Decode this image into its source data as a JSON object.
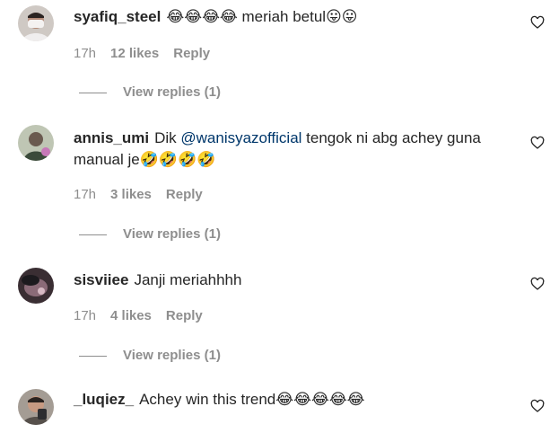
{
  "comments": [
    {
      "username": "syafiq_steel",
      "text_before": "",
      "mention": "",
      "text": "😂😂😂😂 meriah betul😛😛",
      "time": "17h",
      "likes": "12 likes",
      "reply": "Reply",
      "view_replies": "View replies (1)"
    },
    {
      "username": "annis_umi",
      "text_before": "Dik ",
      "mention": "@wanisyazofficial",
      "text": " tengok ni abg achey guna manual je🤣🤣🤣🤣",
      "time": "17h",
      "likes": "3 likes",
      "reply": "Reply",
      "view_replies": "View replies (1)"
    },
    {
      "username": "sisviiee",
      "text_before": "",
      "mention": "",
      "text": "Janji meriahhhh",
      "time": "17h",
      "likes": "4 likes",
      "reply": "Reply",
      "view_replies": "View replies (1)"
    },
    {
      "username": "_luqiez_",
      "text_before": "",
      "mention": "",
      "text": "Achey win this trend😂😂😂😂😂",
      "time": "",
      "likes": "",
      "reply": "",
      "view_replies": ""
    }
  ],
  "colors": {
    "text": "#262626",
    "muted": "#8e8e8e",
    "mention": "#00376b"
  },
  "icons": {
    "like": "heart-icon"
  }
}
